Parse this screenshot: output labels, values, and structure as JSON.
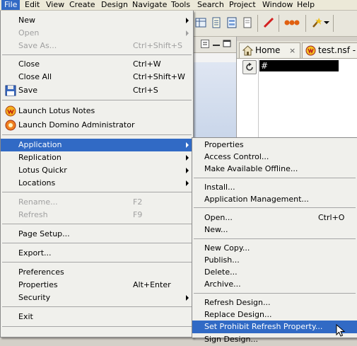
{
  "menubar": {
    "items": [
      "File",
      "Edit",
      "View",
      "Create",
      "Design",
      "Navigate",
      "Tools",
      "Search",
      "Project",
      "Window",
      "Help"
    ],
    "active": "File"
  },
  "tabs": [
    {
      "label": "Home",
      "close": "×"
    },
    {
      "label": "test.nsf - ...",
      "close": ""
    }
  ],
  "view": {
    "column_header": "#"
  },
  "file_menu": {
    "new": {
      "label": "New"
    },
    "open": {
      "label": "Open"
    },
    "save_as": {
      "label": "Save As...",
      "shortcut": "Ctrl+Shift+S"
    },
    "close": {
      "label": "Close",
      "shortcut": "Ctrl+W"
    },
    "close_all": {
      "label": "Close All",
      "shortcut": "Ctrl+Shift+W"
    },
    "save": {
      "label": "Save",
      "shortcut": "Ctrl+S"
    },
    "launch_notes": {
      "label": "Launch Lotus Notes"
    },
    "launch_admin": {
      "label": "Launch Domino Administrator"
    },
    "application": {
      "label": "Application"
    },
    "replication": {
      "label": "Replication"
    },
    "quickr": {
      "label": "Lotus Quickr"
    },
    "locations": {
      "label": "Locations"
    },
    "rename": {
      "label": "Rename...",
      "shortcut": "F2"
    },
    "refresh": {
      "label": "Refresh",
      "shortcut": "F9"
    },
    "page_setup": {
      "label": "Page Setup..."
    },
    "export": {
      "label": "Export..."
    },
    "preferences": {
      "label": "Preferences"
    },
    "properties": {
      "label": "Properties",
      "shortcut": "Alt+Enter"
    },
    "security": {
      "label": "Security"
    },
    "exit": {
      "label": "Exit"
    }
  },
  "application_menu": {
    "properties": {
      "label": "Properties"
    },
    "access_control": {
      "label": "Access Control..."
    },
    "make_available_offline": {
      "label": "Make Available Offline..."
    },
    "install": {
      "label": "Install..."
    },
    "app_management": {
      "label": "Application Management..."
    },
    "open": {
      "label": "Open...",
      "shortcut": "Ctrl+O"
    },
    "new": {
      "label": "New..."
    },
    "new_copy": {
      "label": "New Copy..."
    },
    "publish": {
      "label": "Publish..."
    },
    "delete": {
      "label": "Delete..."
    },
    "archive": {
      "label": "Archive..."
    },
    "refresh_design": {
      "label": "Refresh Design..."
    },
    "replace_design": {
      "label": "Replace Design..."
    },
    "set_prohibit_refresh": {
      "label": "Set Prohibit Refresh Property..."
    },
    "sign_design": {
      "label": "Sign Design..."
    }
  },
  "colors": {
    "highlight": "#316ac5",
    "menu_background": "#f0f0ec",
    "disabled_text": "#a0a0a0"
  }
}
